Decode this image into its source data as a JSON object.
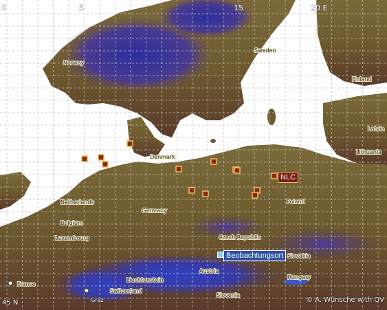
{
  "map": {
    "longitude_labels": [
      "0",
      "5",
      "15",
      "20 E"
    ],
    "latitude_label": "45 N",
    "countries": [
      "Norway",
      "Sweden",
      "Finland",
      "Denmark",
      "Latvia",
      "Lithuania",
      "Netherlands",
      "Belgium",
      "Germany",
      "Poland",
      "Luxembourg",
      "Czech Republic",
      "Slovakia",
      "Austria",
      "Hungary",
      "Liechtenstein",
      "Switzerland",
      "Slovenia",
      "France"
    ],
    "cities": [
      "Graz"
    ],
    "markers": [
      {
        "type": "NLC report",
        "count": 13
      },
      {
        "type": "observation site",
        "count": 1
      }
    ],
    "nlc_label": "NLC",
    "observation_label": "Beobachtungsort",
    "copyright": "© A. Wünsche with QV",
    "colors": {
      "water": "#ffffff",
      "lowland": "#6e5a2e",
      "mountains": "#2a2f9e",
      "marker_fill": "#8a2a10",
      "marker_border": "#f0c060",
      "grid": "#c0c0c0"
    }
  }
}
